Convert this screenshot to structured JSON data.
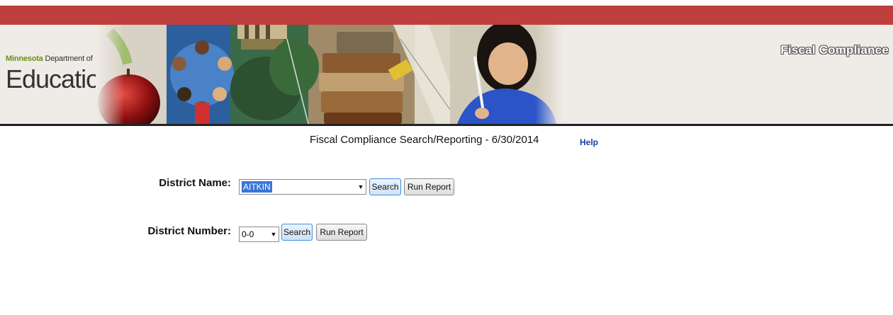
{
  "header": {
    "logo_state": "Minnesota",
    "logo_dept": " Department of",
    "logo_education": "Education",
    "section_title": "Fiscal Compliance"
  },
  "page": {
    "title": "Fiscal Compliance Search/Reporting - 6/30/2014",
    "help_label": "Help"
  },
  "district_name_row": {
    "label": "District Name:",
    "selected": "AITKIN",
    "search_label": "Search",
    "run_report_label": "Run Report"
  },
  "district_number_row": {
    "label": "District Number:",
    "selected": "0-0",
    "search_label": "Search",
    "run_report_label": "Run Report"
  },
  "colors": {
    "red_bar": "#bf3f3f",
    "header_bg": "#efebe6",
    "logo_green": "#6a8f1a",
    "help_link": "#1a3e9e",
    "selection": "#3875d7"
  }
}
